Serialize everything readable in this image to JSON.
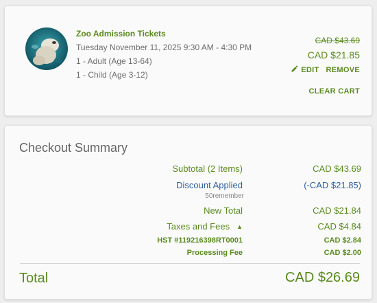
{
  "colors": {
    "accent_green": "#5a8a1e",
    "discount_blue": "#2e5f9e",
    "muted_text": "#6d6d6d"
  },
  "cart": {
    "item": {
      "image_icon": "polar-bear-photo",
      "title": "Zoo Admission Tickets",
      "date": "Tuesday November 11, 2025 9:30 AM - 4:30 PM",
      "tickets": [
        "1 - Adult (Age 13-64)",
        "1 - Child (Age 3-12)"
      ],
      "original_price": "CAD $43.69",
      "price": "CAD $21.85"
    },
    "actions": {
      "edit_label": "EDIT",
      "edit_icon": "pencil-icon",
      "remove_label": "REMOVE",
      "clear_cart_label": "CLEAR CART"
    }
  },
  "summary": {
    "title": "Checkout Summary",
    "subtotal_label": "Subtotal (2 Items)",
    "subtotal_value": "CAD $43.69",
    "discount_label": "Discount Applied",
    "discount_value": "(-CAD $21.85)",
    "discount_code": "50remember",
    "new_total_label": "New Total",
    "new_total_value": "CAD $21.84",
    "taxes_label": "Taxes and Fees",
    "taxes_toggle_icon": "chevron-up-icon",
    "taxes_value": "CAD $4.84",
    "hst_label": "HST #119216398RT0001",
    "hst_value": "CAD $2.84",
    "processing_label": "Processing Fee",
    "processing_value": "CAD $2.00",
    "total_label": "Total",
    "total_value": "CAD $26.69"
  }
}
